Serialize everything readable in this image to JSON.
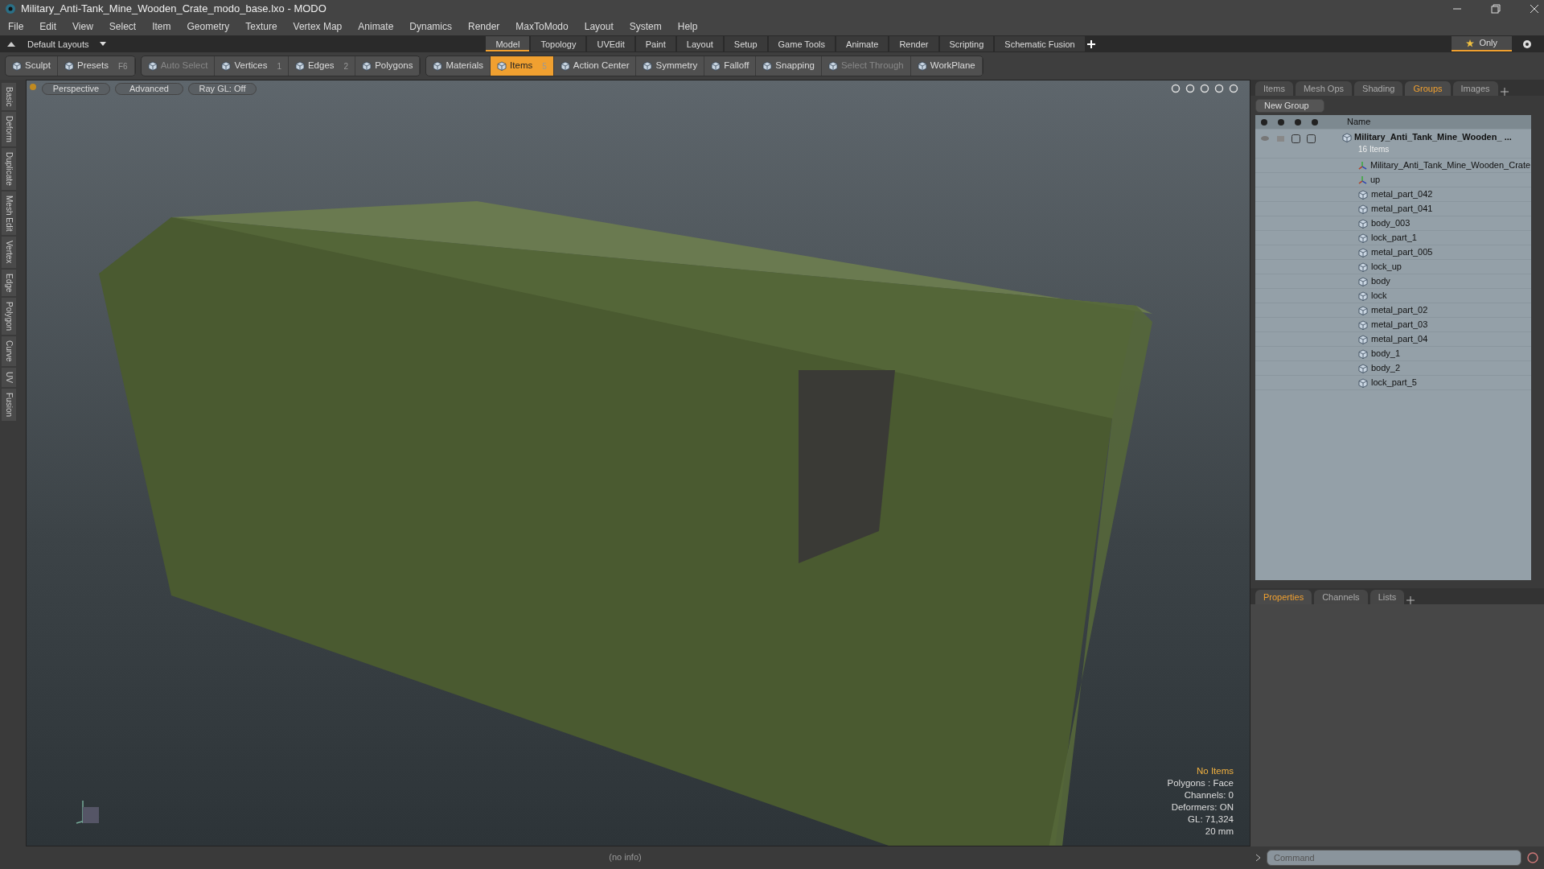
{
  "window": {
    "title": "Military_Anti-Tank_Mine_Wooden_Crate_modo_base.lxo - MODO"
  },
  "menu": [
    "File",
    "Edit",
    "View",
    "Select",
    "Item",
    "Geometry",
    "Texture",
    "Vertex Map",
    "Animate",
    "Dynamics",
    "Render",
    "MaxToModo",
    "Layout",
    "System",
    "Help"
  ],
  "layout_selector": "Default Layouts",
  "layout_tabs": [
    {
      "label": "Model",
      "selected": true
    },
    {
      "label": "Topology",
      "selected": false
    },
    {
      "label": "UVEdit",
      "selected": false
    },
    {
      "label": "Paint",
      "selected": false
    },
    {
      "label": "Layout",
      "selected": false
    },
    {
      "label": "Setup",
      "selected": false
    },
    {
      "label": "Game Tools",
      "selected": false
    },
    {
      "label": "Animate",
      "selected": false
    },
    {
      "label": "Render",
      "selected": false
    },
    {
      "label": "Scripting",
      "selected": false
    },
    {
      "label": "Schematic Fusion",
      "selected": false
    }
  ],
  "only_button": "Only",
  "toolbar": [
    [
      {
        "label": "Sculpt",
        "selected": false,
        "disabled": false
      },
      {
        "label": "Presets",
        "shortcut": "F6",
        "selected": false,
        "disabled": false
      }
    ],
    [
      {
        "label": "Auto Select",
        "selected": false,
        "disabled": true
      },
      {
        "label": "Vertices",
        "shortcut": "1",
        "selected": false,
        "disabled": false
      },
      {
        "label": "Edges",
        "shortcut": "2",
        "selected": false,
        "disabled": false
      },
      {
        "label": "Polygons",
        "selected": false,
        "disabled": false
      }
    ],
    [
      {
        "label": "Materials",
        "selected": false,
        "disabled": false
      },
      {
        "label": "Items",
        "shortcut": "5",
        "selected": true,
        "disabled": false
      },
      {
        "label": "Action Center",
        "selected": false,
        "disabled": false
      },
      {
        "label": "Symmetry",
        "selected": false,
        "disabled": false
      },
      {
        "label": "Falloff",
        "selected": false,
        "disabled": false
      },
      {
        "label": "Snapping",
        "selected": false,
        "disabled": false
      },
      {
        "label": "Select Through",
        "selected": false,
        "disabled": true
      },
      {
        "label": "WorkPlane",
        "selected": false,
        "disabled": false
      }
    ]
  ],
  "left_tabs": [
    "Basic",
    "Deform",
    "Duplicate",
    "Mesh Edit",
    "Vertex",
    "Edge",
    "Polygon",
    "Curve",
    "UV",
    "Fusion"
  ],
  "viewport": {
    "buttons": [
      "Perspective",
      "Advanced",
      "Ray GL: Off"
    ],
    "info": [
      {
        "text": "No Items",
        "kind": "highlight"
      },
      {
        "text": "Polygons : Face",
        "kind": "normal"
      },
      {
        "text": "Channels: 0",
        "kind": "normal"
      },
      {
        "text": "Deformers: ON",
        "kind": "normal"
      },
      {
        "text": "GL: 71,324",
        "kind": "normal"
      },
      {
        "text": "20 mm",
        "kind": "normal"
      }
    ]
  },
  "status_bar": "(no info)",
  "panel_tabs": [
    {
      "label": "Items",
      "selected": false
    },
    {
      "label": "Mesh Ops",
      "selected": false
    },
    {
      "label": "Shading",
      "selected": false
    },
    {
      "label": "Groups",
      "selected": true
    },
    {
      "label": "Images",
      "selected": false
    }
  ],
  "new_group_button": "New Group",
  "name_column": "Name",
  "tree": {
    "name": "Military_Anti_Tank_Mine_Wooden_ ...",
    "count": "16 Items",
    "children": [
      {
        "name": "Military_Anti_Tank_Mine_Wooden_Crate",
        "kind": "locator"
      },
      {
        "name": "up",
        "kind": "locator"
      },
      {
        "name": "metal_part_042",
        "kind": "mesh"
      },
      {
        "name": "metal_part_041",
        "kind": "mesh"
      },
      {
        "name": "body_003",
        "kind": "mesh"
      },
      {
        "name": "lock_part_1",
        "kind": "mesh"
      },
      {
        "name": "metal_part_005",
        "kind": "mesh"
      },
      {
        "name": "lock_up",
        "kind": "mesh"
      },
      {
        "name": "body",
        "kind": "mesh"
      },
      {
        "name": "lock",
        "kind": "mesh"
      },
      {
        "name": "metal_part_02",
        "kind": "mesh"
      },
      {
        "name": "metal_part_03",
        "kind": "mesh"
      },
      {
        "name": "metal_part_04",
        "kind": "mesh"
      },
      {
        "name": "body_1",
        "kind": "mesh"
      },
      {
        "name": "body_2",
        "kind": "mesh"
      },
      {
        "name": "lock_part_5",
        "kind": "mesh"
      }
    ]
  },
  "bottom_tabs": [
    {
      "label": "Properties",
      "selected": true
    },
    {
      "label": "Channels",
      "selected": false
    },
    {
      "label": "Lists",
      "selected": false
    }
  ],
  "command": {
    "placeholder": "Command"
  }
}
